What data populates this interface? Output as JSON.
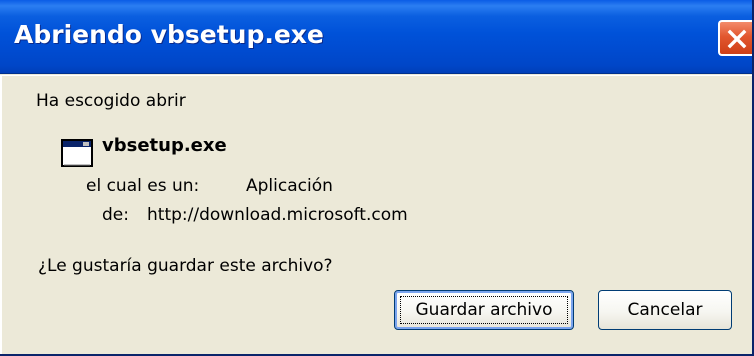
{
  "window": {
    "title": "Abriendo vbsetup.exe",
    "close_icon": "close-icon"
  },
  "dialog": {
    "intro": "Ha escogido abrir",
    "file_icon": "application-window-icon",
    "file_name": "vbsetup.exe",
    "type_label": "el cual es un:",
    "type_value": "Aplicación",
    "from_label": "de:",
    "from_value": "http://download.microsoft.com",
    "question": "¿Le gustaría guardar este archivo?"
  },
  "buttons": {
    "save_label": "Guardar archivo",
    "cancel_label": "Cancelar"
  },
  "colors": {
    "titlebar": "#0052d9",
    "close": "#e2572f",
    "dialog_bg": "#ece9d8"
  }
}
